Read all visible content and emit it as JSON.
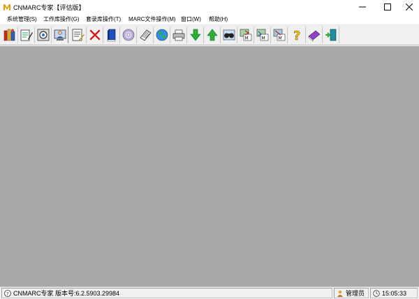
{
  "window": {
    "title": "CNMARC专家【评估版】"
  },
  "menu": {
    "items": [
      {
        "label": "系统管理(S)"
      },
      {
        "label": "工作库操作(G)"
      },
      {
        "label": "套录库操作(T)"
      },
      {
        "label": "MARC文件操作(M)"
      },
      {
        "label": "窗口(W)"
      },
      {
        "label": "帮助(H)"
      }
    ]
  },
  "toolbar": {
    "buttons": [
      {
        "icon": "books-icon"
      },
      {
        "icon": "edit-record-icon"
      },
      {
        "icon": "view-record-icon"
      },
      {
        "icon": "user-record-icon"
      },
      {
        "icon": "edit-list-icon"
      },
      {
        "icon": "delete-icon"
      },
      {
        "icon": "blue-book-icon"
      },
      {
        "icon": "cd-icon"
      },
      {
        "icon": "notebook-icon"
      },
      {
        "icon": "globe-icon"
      },
      {
        "icon": "printer-icon"
      },
      {
        "icon": "download-icon"
      },
      {
        "icon": "upload-icon"
      },
      {
        "icon": "binoculars-icon"
      },
      {
        "icon": "import-marc-icon"
      },
      {
        "icon": "export-marc-icon"
      },
      {
        "icon": "convert-marc-icon"
      },
      {
        "icon": "help-icon"
      },
      {
        "icon": "purple-book-icon"
      },
      {
        "icon": "exit-icon"
      }
    ]
  },
  "workspace": {
    "background": "#a8a8a8"
  },
  "status": {
    "app_version": "CNMARC专家  版本号:6.2.5903.29984",
    "user": "管理员",
    "time": "15:05:33"
  },
  "colors": {
    "logo": "#e8a000",
    "close_hover": "#ffffff"
  }
}
